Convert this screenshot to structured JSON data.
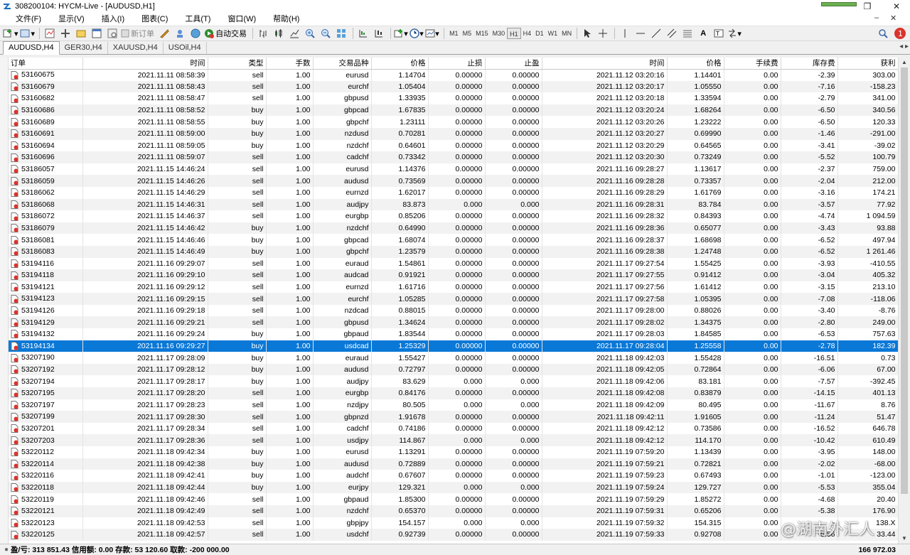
{
  "window": {
    "title": "308200104: HYCM-Live - [AUDUSD,H1]"
  },
  "menu": [
    "文件(F)",
    "显示(V)",
    "插入(I)",
    "图表(C)",
    "工具(T)",
    "窗口(W)",
    "帮助(H)"
  ],
  "toolbar": {
    "new_order_label": "新订单",
    "autotrade_label": "自动交易",
    "timeframes": [
      "M1",
      "M5",
      "M15",
      "M30",
      "H1",
      "H4",
      "D1",
      "W1",
      "MN"
    ],
    "active_timeframe": "H1",
    "notification_count": "1"
  },
  "tabs": [
    {
      "label": "AUDUSD,H4",
      "active": true
    },
    {
      "label": "GER30,H4",
      "active": false
    },
    {
      "label": "XAUUSD,H4",
      "active": false
    },
    {
      "label": "USOil,H4",
      "active": false
    }
  ],
  "table": {
    "columns": [
      "订单",
      "时间",
      "类型",
      "手数",
      "交易品种",
      "价格",
      "止损",
      "止盈",
      "时间",
      "价格",
      "手续费",
      "库存费",
      "获利"
    ],
    "selected_order": "53194134",
    "rows": [
      [
        "53160675",
        "2021.11.11 08:58:39",
        "sell",
        "1.00",
        "eurusd",
        "1.14704",
        "0.00000",
        "0.00000",
        "2021.11.12 03:20:16",
        "1.14401",
        "0.00",
        "-2.39",
        "303.00"
      ],
      [
        "53160679",
        "2021.11.11 08:58:43",
        "sell",
        "1.00",
        "eurchf",
        "1.05404",
        "0.00000",
        "0.00000",
        "2021.11.12 03:20:17",
        "1.05550",
        "0.00",
        "-7.16",
        "-158.23"
      ],
      [
        "53160682",
        "2021.11.11 08:58:47",
        "sell",
        "1.00",
        "gbpusd",
        "1.33935",
        "0.00000",
        "0.00000",
        "2021.11.12 03:20:18",
        "1.33594",
        "0.00",
        "-2.79",
        "341.00"
      ],
      [
        "53160686",
        "2021.11.11 08:58:52",
        "buy",
        "1.00",
        "gbpcad",
        "1.67835",
        "0.00000",
        "0.00000",
        "2021.11.12 03:20:24",
        "1.68264",
        "0.00",
        "-6.50",
        "340.56"
      ],
      [
        "53160689",
        "2021.11.11 08:58:55",
        "buy",
        "1.00",
        "gbpchf",
        "1.23111",
        "0.00000",
        "0.00000",
        "2021.11.12 03:20:26",
        "1.23222",
        "0.00",
        "-6.50",
        "120.33"
      ],
      [
        "53160691",
        "2021.11.11 08:59:00",
        "buy",
        "1.00",
        "nzdusd",
        "0.70281",
        "0.00000",
        "0.00000",
        "2021.11.12 03:20:27",
        "0.69990",
        "0.00",
        "-1.46",
        "-291.00"
      ],
      [
        "53160694",
        "2021.11.11 08:59:05",
        "buy",
        "1.00",
        "nzdchf",
        "0.64601",
        "0.00000",
        "0.00000",
        "2021.11.12 03:20:29",
        "0.64565",
        "0.00",
        "-3.41",
        "-39.02"
      ],
      [
        "53160696",
        "2021.11.11 08:59:07",
        "sell",
        "1.00",
        "cadchf",
        "0.73342",
        "0.00000",
        "0.00000",
        "2021.11.12 03:20:30",
        "0.73249",
        "0.00",
        "-5.52",
        "100.79"
      ],
      [
        "53186057",
        "2021.11.15 14:46:24",
        "sell",
        "1.00",
        "eurusd",
        "1.14376",
        "0.00000",
        "0.00000",
        "2021.11.16 09:28:27",
        "1.13617",
        "0.00",
        "-2.37",
        "759.00"
      ],
      [
        "53186059",
        "2021.11.15 14:46:26",
        "sell",
        "1.00",
        "audusd",
        "0.73569",
        "0.00000",
        "0.00000",
        "2021.11.16 09:28:28",
        "0.73357",
        "0.00",
        "-2.04",
        "212.00"
      ],
      [
        "53186062",
        "2021.11.15 14:46:29",
        "sell",
        "1.00",
        "eurnzd",
        "1.62017",
        "0.00000",
        "0.00000",
        "2021.11.16 09:28:29",
        "1.61769",
        "0.00",
        "-3.16",
        "174.21"
      ],
      [
        "53186068",
        "2021.11.15 14:46:31",
        "sell",
        "1.00",
        "audjpy",
        "83.873",
        "0.000",
        "0.000",
        "2021.11.16 09:28:31",
        "83.784",
        "0.00",
        "-3.57",
        "77.92"
      ],
      [
        "53186072",
        "2021.11.15 14:46:37",
        "sell",
        "1.00",
        "eurgbp",
        "0.85206",
        "0.00000",
        "0.00000",
        "2021.11.16 09:28:32",
        "0.84393",
        "0.00",
        "-4.74",
        "1 094.59"
      ],
      [
        "53186079",
        "2021.11.15 14:46:42",
        "buy",
        "1.00",
        "nzdchf",
        "0.64990",
        "0.00000",
        "0.00000",
        "2021.11.16 09:28:36",
        "0.65077",
        "0.00",
        "-3.43",
        "93.88"
      ],
      [
        "53186081",
        "2021.11.15 14:46:46",
        "buy",
        "1.00",
        "gbpcad",
        "1.68074",
        "0.00000",
        "0.00000",
        "2021.11.16 09:28:37",
        "1.68698",
        "0.00",
        "-6.52",
        "497.94"
      ],
      [
        "53186083",
        "2021.11.15 14:46:49",
        "buy",
        "1.00",
        "gbpchf",
        "1.23579",
        "0.00000",
        "0.00000",
        "2021.11.16 09:28:38",
        "1.24748",
        "0.00",
        "-6.52",
        "1 261.46"
      ],
      [
        "53194116",
        "2021.11.16 09:29:07",
        "sell",
        "1.00",
        "euraud",
        "1.54861",
        "0.00000",
        "0.00000",
        "2021.11.17 09:27:54",
        "1.55425",
        "0.00",
        "-3.93",
        "-410.55"
      ],
      [
        "53194118",
        "2021.11.16 09:29:10",
        "sell",
        "1.00",
        "audcad",
        "0.91921",
        "0.00000",
        "0.00000",
        "2021.11.17 09:27:55",
        "0.91412",
        "0.00",
        "-3.04",
        "405.32"
      ],
      [
        "53194121",
        "2021.11.16 09:29:12",
        "sell",
        "1.00",
        "eurnzd",
        "1.61716",
        "0.00000",
        "0.00000",
        "2021.11.17 09:27:56",
        "1.61412",
        "0.00",
        "-3.15",
        "213.10"
      ],
      [
        "53194123",
        "2021.11.16 09:29:15",
        "sell",
        "1.00",
        "eurchf",
        "1.05285",
        "0.00000",
        "0.00000",
        "2021.11.17 09:27:58",
        "1.05395",
        "0.00",
        "-7.08",
        "-118.06"
      ],
      [
        "53194126",
        "2021.11.16 09:29:18",
        "sell",
        "1.00",
        "nzdcad",
        "0.88015",
        "0.00000",
        "0.00000",
        "2021.11.17 09:28:00",
        "0.88026",
        "0.00",
        "-3.40",
        "-8.76"
      ],
      [
        "53194129",
        "2021.11.16 09:29:21",
        "sell",
        "1.00",
        "gbpusd",
        "1.34624",
        "0.00000",
        "0.00000",
        "2021.11.17 09:28:02",
        "1.34375",
        "0.00",
        "-2.80",
        "249.00"
      ],
      [
        "53194132",
        "2021.11.16 09:29:24",
        "buy",
        "1.00",
        "gbpaud",
        "1.83544",
        "0.00000",
        "0.00000",
        "2021.11.17 09:28:03",
        "1.84585",
        "0.00",
        "-6.53",
        "757.63"
      ],
      [
        "53194134",
        "2021.11.16 09:29:27",
        "buy",
        "1.00",
        "usdcad",
        "1.25329",
        "0.00000",
        "0.00000",
        "2021.11.17 09:28:04",
        "1.25558",
        "0.00",
        "-2.78",
        "182.39"
      ],
      [
        "53207190",
        "2021.11.17 09:28:09",
        "buy",
        "1.00",
        "euraud",
        "1.55427",
        "0.00000",
        "0.00000",
        "2021.11.18 09:42:03",
        "1.55428",
        "0.00",
        "-16.51",
        "0.73"
      ],
      [
        "53207192",
        "2021.11.17 09:28:12",
        "buy",
        "1.00",
        "audusd",
        "0.72797",
        "0.00000",
        "0.00000",
        "2021.11.18 09:42:05",
        "0.72864",
        "0.00",
        "-6.06",
        "67.00"
      ],
      [
        "53207194",
        "2021.11.17 09:28:17",
        "buy",
        "1.00",
        "audjpy",
        "83.629",
        "0.000",
        "0.000",
        "2021.11.18 09:42:06",
        "83.181",
        "0.00",
        "-7.57",
        "-392.45"
      ],
      [
        "53207195",
        "2021.11.17 09:28:20",
        "sell",
        "1.00",
        "eurgbp",
        "0.84176",
        "0.00000",
        "0.00000",
        "2021.11.18 09:42:08",
        "0.83879",
        "0.00",
        "-14.15",
        "401.13"
      ],
      [
        "53207197",
        "2021.11.17 09:28:23",
        "sell",
        "1.00",
        "nzdjpy",
        "80.505",
        "0.000",
        "0.000",
        "2021.11.18 09:42:09",
        "80.495",
        "0.00",
        "-11.67",
        "8.76"
      ],
      [
        "53207199",
        "2021.11.17 09:28:30",
        "sell",
        "1.00",
        "gbpnzd",
        "1.91678",
        "0.00000",
        "0.00000",
        "2021.11.18 09:42:11",
        "1.91605",
        "0.00",
        "-11.24",
        "51.47"
      ],
      [
        "53207201",
        "2021.11.17 09:28:34",
        "sell",
        "1.00",
        "cadchf",
        "0.74186",
        "0.00000",
        "0.00000",
        "2021.11.18 09:42:12",
        "0.73586",
        "0.00",
        "-16.52",
        "646.78"
      ],
      [
        "53207203",
        "2021.11.17 09:28:36",
        "sell",
        "1.00",
        "usdjpy",
        "114.867",
        "0.000",
        "0.000",
        "2021.11.18 09:42:12",
        "114.170",
        "0.00",
        "-10.42",
        "610.49"
      ],
      [
        "53220112",
        "2021.11.18 09:42:34",
        "buy",
        "1.00",
        "eurusd",
        "1.13291",
        "0.00000",
        "0.00000",
        "2021.11.19 07:59:20",
        "1.13439",
        "0.00",
        "-3.95",
        "148.00"
      ],
      [
        "53220114",
        "2021.11.18 09:42:38",
        "buy",
        "1.00",
        "audusd",
        "0.72889",
        "0.00000",
        "0.00000",
        "2021.11.19 07:59:21",
        "0.72821",
        "0.00",
        "-2.02",
        "-68.00"
      ],
      [
        "53220116",
        "2021.11.18 09:42:41",
        "buy",
        "1.00",
        "audchf",
        "0.67607",
        "0.00000",
        "0.00000",
        "2021.11.19 07:59:23",
        "0.67493",
        "0.00",
        "-1.01",
        "-123.00"
      ],
      [
        "53220118",
        "2021.11.18 09:42:44",
        "buy",
        "1.00",
        "eurjpy",
        "129.321",
        "0.000",
        "0.000",
        "2021.11.19 07:59:24",
        "129.727",
        "0.00",
        "-5.53",
        "355.04"
      ],
      [
        "53220119",
        "2021.11.18 09:42:46",
        "sell",
        "1.00",
        "gbpaud",
        "1.85300",
        "0.00000",
        "0.00000",
        "2021.11.19 07:59:29",
        "1.85272",
        "0.00",
        "-4.68",
        "20.40"
      ],
      [
        "53220121",
        "2021.11.18 09:42:49",
        "sell",
        "1.00",
        "nzdchf",
        "0.65370",
        "0.00000",
        "0.00000",
        "2021.11.19 07:59:31",
        "0.65206",
        "0.00",
        "-5.38",
        "176.90"
      ],
      [
        "53220123",
        "2021.11.18 09:42:53",
        "sell",
        "1.00",
        "gbpjpy",
        "154.157",
        "0.000",
        "0.000",
        "2021.11.19 07:59:32",
        "154.315",
        "0.00",
        "-",
        "138.X"
      ],
      [
        "53220125",
        "2021.11.18 09:42:57",
        "sell",
        "1.00",
        "usdchf",
        "0.92739",
        "0.00000",
        "0.00000",
        "2021.11.19 07:59:33",
        "0.92708",
        "0.00",
        "-5.56",
        "33.44"
      ]
    ]
  },
  "status": {
    "summary": "盈/亏: 313 851.43  信用额: 0.00  存款: 53 120.60  取款: -200 000.00",
    "total": "166 972.03"
  },
  "watermark": "@湖南外汇人",
  "colors": {
    "selected_row": "#0a78d7",
    "alt_row": "#f2f2f2",
    "order_icon_red": "#d9342b"
  }
}
